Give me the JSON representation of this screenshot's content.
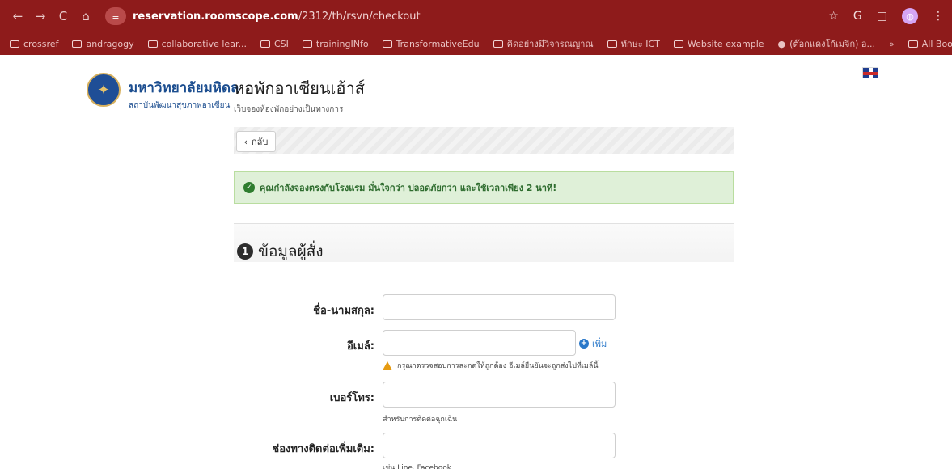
{
  "browser": {
    "back_icon": "←",
    "forward_icon": "→",
    "reload_icon": "C",
    "home_icon": "⌂",
    "site_icon": "≡",
    "url_domain": "reservation.roomscope.com",
    "url_path": "/2312/th/rsvn/checkout",
    "star_icon": "☆",
    "g_icon": "G",
    "puzzle_icon": "□",
    "profile_icon": "◍",
    "menu_icon": "⋮"
  },
  "bookmarks": [
    "crossref",
    "andragogy",
    "collaborative lear...",
    "CSI",
    "trainingINfo",
    "TransformativeEdu",
    "คิดอย่างมีวิจารณญาณ",
    "ทักษะ ICT",
    "Website example",
    "(ต๊อกแดงโก้เมจิก) อ...",
    "»",
    "All Bookmarks"
  ],
  "header": {
    "university": "มหาวิทยาลัยมหิดล",
    "institute": "สถาบันพัฒนาสุขภาพอาเซียน",
    "hotel_title": "หอพักอาเซียนเฮ้าส์",
    "hotel_subtitle": "เว็บจองห้องพักอย่างเป็นทางการ"
  },
  "actions": {
    "back_label": "กลับ",
    "back_icon": "‹"
  },
  "alert": {
    "icon": "✓",
    "message": "คุณกำลังจองตรงกับโรงแรม มั่นใจกว่า ปลอดภัยกว่า และใช้เวลาเพียง 2 นาที!"
  },
  "section": {
    "step_number": "1",
    "title": "ข้อมูลผู้สั่ง"
  },
  "form": {
    "name_label": "ชื่อ-นามสกุล:",
    "email_label": "อีเมล์:",
    "phone_label": "เบอร์โทร:",
    "contact_label": "ช่องทางติดต่อเพิ่มเติม:",
    "add_label": "เพิ่ม",
    "email_warning": "กรุณาตรวจสอบการสะกดให้ถูกต้อง อีเมล์ยืนยันจะถูกส่งไปที่เมล์นี้",
    "phone_help": "สำหรับการติดต่อฉุกเฉิน",
    "contact_help": "เช่น Line, Facebook"
  },
  "colors": {
    "browser_red": "#8e1b1b",
    "success_green": "#dff0d8",
    "link_blue": "#2a78c9",
    "warning_orange": "#e69b12"
  }
}
